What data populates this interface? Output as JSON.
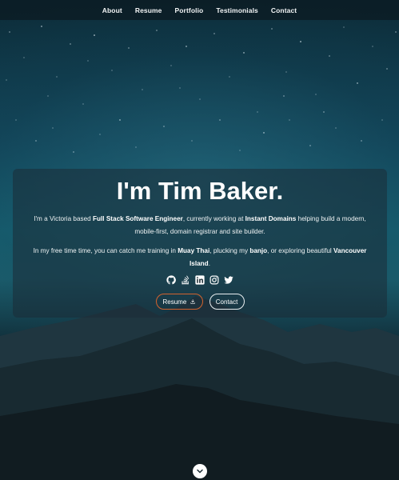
{
  "nav": {
    "items": [
      "About",
      "Resume",
      "Portfolio",
      "Testimonials",
      "Contact"
    ]
  },
  "hero": {
    "title": "I'm Tim Baker.",
    "intro": {
      "t1": "I'm a Victoria based ",
      "b1": "Full Stack Software Engineer",
      "t2": ", currently working at ",
      "b2": "Instant Domains",
      "t3": " helping build a modern, mobile-first, domain registrar and site builder."
    },
    "free_time": {
      "t1": "In my free time time, you can catch me training in ",
      "b1": "Muay Thai",
      "t2": ", plucking my ",
      "b2": "banjo",
      "t3": ", or exploring beautiful ",
      "b3": "Vancouver Island",
      "t4": "."
    },
    "social_icons": [
      "github-icon",
      "stack-overflow-icon",
      "linkedin-icon",
      "instagram-icon",
      "twitter-icon"
    ],
    "buttons": {
      "resume": "Resume",
      "contact": "Contact"
    },
    "colors": {
      "accent": "#d2632e",
      "nav_bg": "#0c1c24"
    }
  }
}
